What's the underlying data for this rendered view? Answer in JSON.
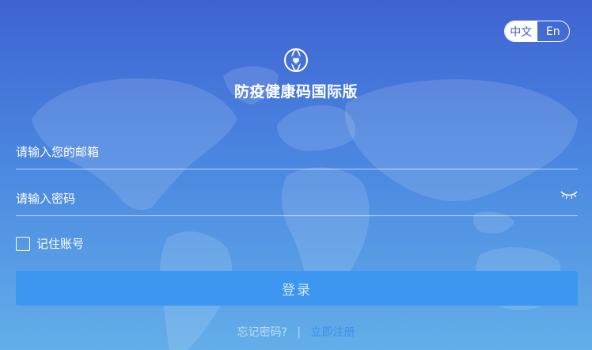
{
  "app": {
    "title": "防疫健康码国际版"
  },
  "lang_toggle": {
    "zh_label": "中文",
    "en_label": "En",
    "active": "zh"
  },
  "form": {
    "email_placeholder": "请输入您的邮箱",
    "email_value": "",
    "password_placeholder": "请输入密码",
    "password_value": "",
    "remember_label": "记住账号",
    "remember_checked": false,
    "login_label": "登录"
  },
  "footer": {
    "forgot_label": "忘记密码?",
    "separator": "|",
    "register_label": "立即注册"
  },
  "icons": {
    "logo": "globe-heart-icon",
    "password_toggle": "eye-closed-icon"
  },
  "colors": {
    "bg_top": "#3f63d2",
    "bg_bottom": "#63aee9",
    "button": "#3d96ef",
    "register_link": "#3d8ff0"
  }
}
